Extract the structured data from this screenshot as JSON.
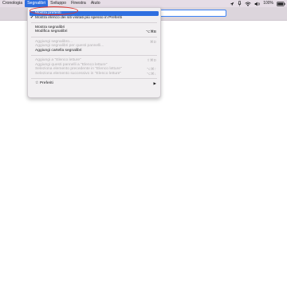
{
  "menubar": {
    "items": [
      "Cronologia",
      "Segnalibri",
      "Sviluppo",
      "Finestra",
      "Aiuto"
    ],
    "active_index": 1,
    "battery_percent": "100%"
  },
  "dropdown": {
    "show_favorites": "Mostra preferiti",
    "show_frequent": "Mostra elenco dei siti visitati più spesso in Preferiti",
    "show_bookmarks": "Mostra segnalibri",
    "edit_bookmarks": "Modifica segnalibri",
    "edit_bookmarks_shortcut": "⌥⌘B",
    "add_bookmark": "Aggiungi segnalibro...",
    "add_bookmark_shortcut": "⌘D",
    "add_bookmarks_tabs": "Aggiungi segnalibri per questi pannelli...",
    "add_bookmark_folder": "Aggiungi cartella segnalibri",
    "add_reading_list": "Aggiungi a \"Elenco letture\"",
    "add_reading_list_shortcut": "⇧⌘D",
    "add_tabs_reading_list": "Aggiungi questi pannelli a \"Elenco letture\"",
    "select_previous": "Seleziona elemento precedente in \"Elenco letture\"",
    "select_previous_shortcut": "⌥⌘↑",
    "select_next": "Seleziona elemento successivo in \"Elenco letture\"",
    "select_next_shortcut": "⌥⌘↓",
    "favorites": "Preferiti"
  },
  "icons": {
    "checkmark": "checkmark-icon",
    "star": "star-icon",
    "submenu": "submenu-arrow-icon"
  },
  "colors": {
    "highlight": "#2f6fe0",
    "annotation": "#e0342f"
  }
}
